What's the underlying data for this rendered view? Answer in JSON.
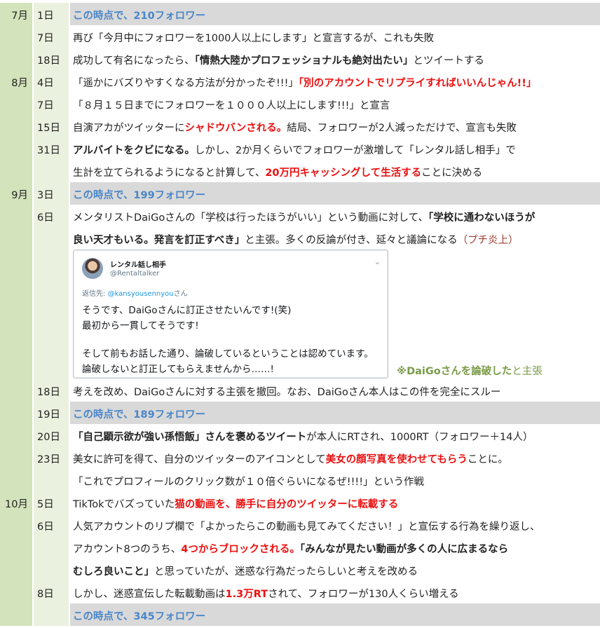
{
  "rows": [
    {
      "month": "7月",
      "day": "1日",
      "highlight": true,
      "text": "この時点で、210フォロワー"
    },
    {
      "day": "7日",
      "text": "再び「今月中にフォロワーを1000人以上にします」と宣言するが、これも失敗"
    },
    {
      "day": "18日",
      "p1": "成功して有名になったら、",
      "p2": "「情熱大陸かプロフェッショナルも絶対出たい」",
      "p3": "とツイートする"
    },
    {
      "month": "8月",
      "day": "4日",
      "p1": "「遥かにバズりやすくなる方法が分かったぞ!!!」",
      "p2": "「別のアカウントでリプライすればいいんじゃん!!」"
    },
    {
      "day": "7日",
      "text": "「８月１５日までにフォロワーを１０００人以上にします!!!」と宣言"
    },
    {
      "day": "15日",
      "p1": "自演アカがツイッターに",
      "p2": "シャドウバンされる。",
      "p3": "結局、フォロワーが2人減っただけで、宣言も失敗"
    },
    {
      "day": "31日",
      "p1": "アルバイトをクビになる。",
      "p2": "しかし、2か月くらいでフォロワーが激増して「レンタル話し相手」で"
    },
    {
      "p1": "生計を立てられるようになると計算して、",
      "p2": "20万円キャッシングして生活する",
      "p3": "ことに決める"
    },
    {
      "month": "9月",
      "day": "3日",
      "highlight": true,
      "text": "この時点で、199フォロワー"
    },
    {
      "day": "6日",
      "p1": "メンタリストDaiGoさんの「学校は行ったほうがいい」という動画に対して、",
      "p2": "「学校に通わないほうが"
    },
    {
      "p1": "良い天才もいる。発言を訂正すべき」",
      "p2": "と主張。多くの反論が付き、延々と議論になる",
      "p3": "（プチ炎上）"
    },
    {
      "day": "18日",
      "text": "考えを改め、DaiGoさんに対する主張を撤回。なお、DaiGoさん本人はこの件を完全にスルー"
    },
    {
      "day": "19日",
      "highlight": true,
      "text": "この時点で、189フォロワー"
    },
    {
      "day": "20日",
      "p1": "「自己顕示欲が強い孫悟飯」さんを褒めるツイート",
      "p2": "が本人にRTされ、1000RT（フォロワー＋14人）"
    },
    {
      "day": "23日",
      "p1": "美女に許可を得て、自分のツイッターのアイコンとして",
      "p2": "美女の顔写真を使わせてもらう",
      "p3": "ことに。"
    },
    {
      "text": "「これでプロフィールのクリック数が１０倍ぐらいになるぜ!!!!」という作戦"
    },
    {
      "month": "10月",
      "day": "5日",
      "p1": "TikTokでバズっていた",
      "p2": "猫の動画を、勝手に自分のツイッターに転載する"
    },
    {
      "day": "6日",
      "text": "人気アカウントのリプ欄で「よかったらこの動画も見てみてください！」と宣伝する行為を繰り返し、"
    },
    {
      "p1": "アカウント8つのうち、",
      "p2": "4つからブロックされる。",
      "p3": "「みんなが見たい動画が多くの人に広まるなら"
    },
    {
      "p1": "むしろ良いこと」",
      "p2": "と思っていたが、迷惑な行為だったらしいと考えを改める"
    },
    {
      "day": "8日",
      "p1": "しかし、迷惑宣伝した転載動画は",
      "p2": "1.3万RT",
      "p3": "されて、フォロワーが130人くらい増える"
    },
    {
      "highlight": true,
      "text": "この時点で、345フォロワー"
    }
  ],
  "tweet": {
    "name": "レンタル話し相手",
    "handle": "@Rentaltalker",
    "reply_prefix": "返信先: ",
    "reply_handle": "@kansyousennyou",
    "reply_suffix": "さん",
    "line1": "そうです、DaiGoさんに訂正させたいんです!(笑)",
    "line2": "最初から一貫してそうです!",
    "line3": "そして前もお話した通り、論破しているということは認めています。",
    "line4": "論破しないと訂正してもらえませんから……!",
    "note_bold": "※DaiGoさんを論破した",
    "note_rest": "と主張"
  }
}
